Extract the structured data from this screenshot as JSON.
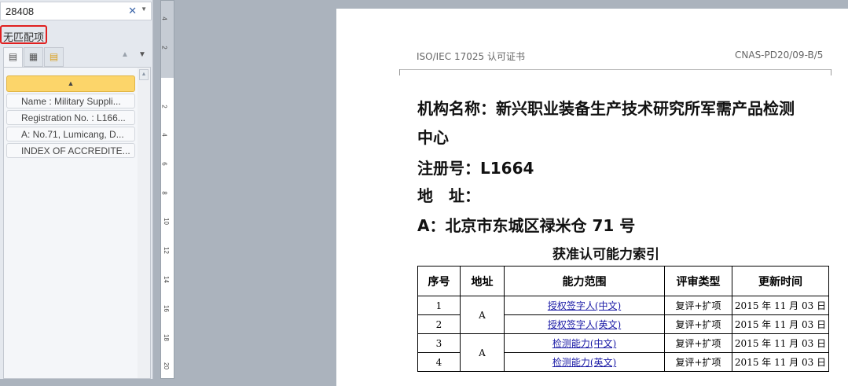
{
  "nav": {
    "search_value": "28408",
    "no_match": "无匹配项",
    "items": [
      "Name : Military Suppli...",
      "Registration No. : L166...",
      "A: No.71, Lumicang, D...",
      "INDEX OF ACCREDITE..."
    ]
  },
  "ruler": [
    "4",
    "2",
    "2",
    "4",
    "6",
    "8",
    "10",
    "12",
    "14",
    "16",
    "18",
    "20"
  ],
  "page": {
    "header_left": "ISO/IEC 17025  认可证书",
    "header_right": "CNAS-PD20/09-B/5",
    "org_line1": "机构名称：新兴职业装备生产技术研究所军需产品检测",
    "org_line2": "中心",
    "reg": "注册号：L1664",
    "addr_label": "地　址：",
    "addr_a": "A：北京市东城区禄米仓 71 号",
    "table_title": "获准认可能力索引",
    "columns": [
      "序号",
      "地址",
      "能力范围",
      "评审类型",
      "更新时间"
    ],
    "rows": [
      {
        "no": "1",
        "addr": "A",
        "scope": "授权签字人(中文)",
        "type": "复评+扩项",
        "date": "2015 年 11 月 03 日"
      },
      {
        "no": "2",
        "addr": "",
        "scope": "授权签字人(英文)",
        "type": "复评+扩项",
        "date": "2015 年 11 月 03 日"
      },
      {
        "no": "3",
        "addr": "A",
        "scope": "检测能力(中文)",
        "type": "复评+扩项",
        "date": "2015 年 11 月 03 日"
      },
      {
        "no": "4",
        "addr": "",
        "scope": "检测能力(英文)",
        "type": "复评+扩项",
        "date": "2015 年 11 月 03 日"
      }
    ]
  }
}
